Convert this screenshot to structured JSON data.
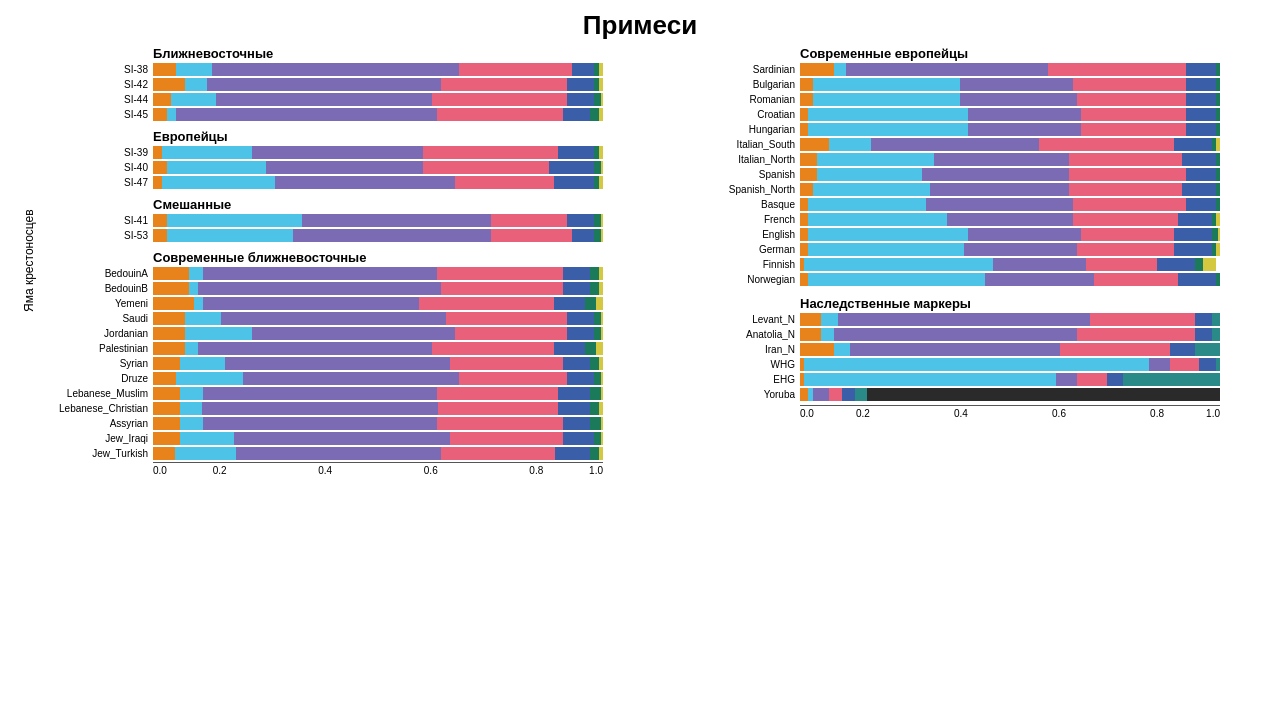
{
  "title": "Примеси",
  "colors": {
    "orange": "#E8821A",
    "blue_light": "#4DC3E8",
    "purple": "#7B6BB5",
    "pink": "#E8607A",
    "blue_dark": "#3A5FA8",
    "green_dark": "#1A7A5A",
    "yellow": "#D4C840",
    "teal": "#2A8A88",
    "gray": "#888888",
    "orange_light": "#F0A050"
  },
  "left": {
    "y_label": "Яма крестоносцев",
    "sections": [
      {
        "title": "Ближневосточные",
        "rows": [
          {
            "label": "SI-38",
            "segments": [
              0.05,
              0.08,
              0.55,
              0.25,
              0.05,
              0.01,
              0.01
            ]
          },
          {
            "label": "SI-42",
            "segments": [
              0.07,
              0.05,
              0.52,
              0.28,
              0.06,
              0.01,
              0.01
            ]
          },
          {
            "label": "SI-44",
            "segments": [
              0.04,
              0.1,
              0.48,
              0.3,
              0.06,
              0.015,
              0.005
            ]
          },
          {
            "label": "SI-45",
            "segments": [
              0.03,
              0.02,
              0.58,
              0.28,
              0.06,
              0.02,
              0.01
            ]
          }
        ]
      },
      {
        "title": "Европейцы",
        "rows": [
          {
            "label": "SI-39",
            "segments": [
              0.02,
              0.2,
              0.38,
              0.3,
              0.08,
              0.01,
              0.01
            ]
          },
          {
            "label": "SI-40",
            "segments": [
              0.03,
              0.22,
              0.35,
              0.28,
              0.1,
              0.015,
              0.005
            ]
          },
          {
            "label": "SI-47",
            "segments": [
              0.02,
              0.25,
              0.4,
              0.22,
              0.09,
              0.01,
              0.01
            ]
          }
        ]
      },
      {
        "title": "Смешанные",
        "rows": [
          {
            "label": "SI-41",
            "segments": [
              0.03,
              0.3,
              0.42,
              0.17,
              0.06,
              0.015,
              0.005
            ]
          },
          {
            "label": "SI-53",
            "segments": [
              0.03,
              0.28,
              0.44,
              0.18,
              0.05,
              0.015,
              0.005
            ]
          }
        ]
      },
      {
        "title": "Современные ближневосточные",
        "rows": [
          {
            "label": "BedouinA",
            "segments": [
              0.08,
              0.03,
              0.52,
              0.28,
              0.06,
              0.02,
              0.01
            ]
          },
          {
            "label": "BedouinB",
            "segments": [
              0.08,
              0.02,
              0.54,
              0.27,
              0.06,
              0.02,
              0.01
            ]
          },
          {
            "label": "Yemeni",
            "segments": [
              0.09,
              0.02,
              0.48,
              0.3,
              0.07,
              0.025,
              0.015
            ]
          },
          {
            "label": "Saudi",
            "segments": [
              0.07,
              0.08,
              0.5,
              0.27,
              0.06,
              0.015,
              0.005
            ]
          },
          {
            "label": "Jordanian",
            "segments": [
              0.07,
              0.15,
              0.45,
              0.25,
              0.06,
              0.015,
              0.005
            ]
          },
          {
            "label": "Palestinian",
            "segments": [
              0.07,
              0.03,
              0.52,
              0.27,
              0.07,
              0.025,
              0.015
            ]
          },
          {
            "label": "Syrian",
            "segments": [
              0.06,
              0.1,
              0.5,
              0.25,
              0.06,
              0.02,
              0.01
            ]
          },
          {
            "label": "Druze",
            "segments": [
              0.05,
              0.15,
              0.48,
              0.24,
              0.06,
              0.015,
              0.005
            ]
          },
          {
            "label": "Lebanese_Muslim",
            "segments": [
              0.06,
              0.05,
              0.52,
              0.27,
              0.07,
              0.025,
              0.005
            ]
          },
          {
            "label": "Lebanese_Christian",
            "segments": [
              0.06,
              0.05,
              0.53,
              0.27,
              0.07,
              0.02,
              0.01
            ]
          },
          {
            "label": "Assyrian",
            "segments": [
              0.06,
              0.05,
              0.52,
              0.28,
              0.06,
              0.025,
              0.005
            ]
          },
          {
            "label": "Jew_Iraqi",
            "segments": [
              0.06,
              0.12,
              0.48,
              0.25,
              0.07,
              0.015,
              0.005
            ]
          },
          {
            "label": "Jew_Turkish",
            "segments": [
              0.05,
              0.14,
              0.47,
              0.26,
              0.08,
              0.02,
              0.01
            ]
          }
        ]
      }
    ],
    "x_axis": [
      "0.0",
      "0.2",
      "0.4",
      "0.6",
      "0.8",
      "1.0"
    ]
  },
  "right": {
    "sections": [
      {
        "title": "Современные  европейцы",
        "rows": [
          {
            "label": "Sardinian",
            "segments": [
              0.08,
              0.03,
              0.48,
              0.33,
              0.07,
              0.01,
              0.0
            ]
          },
          {
            "label": "Bulgarian",
            "segments": [
              0.03,
              0.35,
              0.27,
              0.27,
              0.07,
              0.01,
              0.0
            ]
          },
          {
            "label": "Romanian",
            "segments": [
              0.03,
              0.35,
              0.28,
              0.26,
              0.07,
              0.01,
              0.0
            ]
          },
          {
            "label": "Croatian",
            "segments": [
              0.02,
              0.38,
              0.27,
              0.25,
              0.07,
              0.01,
              0.0
            ]
          },
          {
            "label": "Hungarian",
            "segments": [
              0.02,
              0.38,
              0.27,
              0.25,
              0.07,
              0.01,
              0.0
            ]
          },
          {
            "label": "Italian_South",
            "segments": [
              0.07,
              0.1,
              0.4,
              0.32,
              0.09,
              0.01,
              0.01
            ]
          },
          {
            "label": "Italian_North",
            "segments": [
              0.04,
              0.28,
              0.32,
              0.27,
              0.08,
              0.01,
              0.0
            ]
          },
          {
            "label": "Spanish",
            "segments": [
              0.04,
              0.25,
              0.35,
              0.28,
              0.07,
              0.01,
              0.0
            ]
          },
          {
            "label": "Spanish_North",
            "segments": [
              0.03,
              0.28,
              0.33,
              0.27,
              0.08,
              0.01,
              0.0
            ]
          },
          {
            "label": "Basque",
            "segments": [
              0.02,
              0.28,
              0.35,
              0.27,
              0.07,
              0.01,
              0.0
            ]
          },
          {
            "label": "French",
            "segments": [
              0.02,
              0.33,
              0.3,
              0.25,
              0.08,
              0.01,
              0.01
            ]
          },
          {
            "label": "English",
            "segments": [
              0.02,
              0.38,
              0.27,
              0.22,
              0.09,
              0.015,
              0.005
            ]
          },
          {
            "label": "German",
            "segments": [
              0.02,
              0.37,
              0.27,
              0.23,
              0.09,
              0.01,
              0.01
            ]
          },
          {
            "label": "Finnish",
            "segments": [
              0.01,
              0.45,
              0.22,
              0.17,
              0.09,
              0.02,
              0.03
            ]
          },
          {
            "label": "Norwegian",
            "segments": [
              0.02,
              0.42,
              0.26,
              0.2,
              0.09,
              0.01,
              0.0
            ]
          }
        ]
      },
      {
        "title": "Наследственные маркеры",
        "rows": [
          {
            "label": "Levant_N",
            "segments": [
              0.05,
              0.04,
              0.6,
              0.25,
              0.04,
              0.02,
              0.0
            ]
          },
          {
            "label": "Anatolia_N",
            "segments": [
              0.05,
              0.03,
              0.58,
              0.28,
              0.04,
              0.02,
              0.0
            ]
          },
          {
            "label": "Iran_N",
            "segments": [
              0.08,
              0.04,
              0.5,
              0.26,
              0.06,
              0.06,
              0.0
            ]
          },
          {
            "label": "WHG",
            "segments": [
              0.01,
              0.82,
              0.05,
              0.07,
              0.04,
              0.01,
              0.0
            ]
          },
          {
            "label": "EHG",
            "segments": [
              0.01,
              0.6,
              0.05,
              0.07,
              0.04,
              0.23,
              0.0
            ]
          },
          {
            "label": "Yoruba",
            "segments": [
              0.02,
              0.01,
              0.04,
              0.03,
              0.03,
              0.03,
              0.84
            ]
          }
        ]
      }
    ],
    "x_axis": [
      "0.0",
      "0.2",
      "0.4",
      "0.6",
      "0.8",
      "1.0"
    ]
  }
}
